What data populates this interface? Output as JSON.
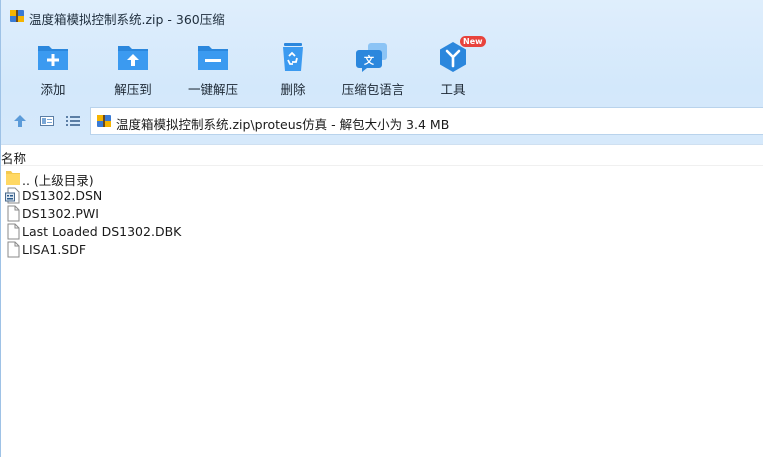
{
  "window": {
    "title": "温度箱模拟控制系统.zip - 360压缩",
    "app_icon": "archive-icon"
  },
  "toolbar": {
    "items": [
      {
        "label": "添加",
        "icon": "add-folder-icon"
      },
      {
        "label": "解压到",
        "icon": "extract-to-icon"
      },
      {
        "label": "一键解压",
        "icon": "one-click-extract-icon"
      },
      {
        "label": "删除",
        "icon": "recycle-bin-icon"
      },
      {
        "label": "压缩包语言",
        "icon": "language-icon"
      },
      {
        "label": "工具",
        "icon": "tools-icon",
        "badge": "New"
      }
    ]
  },
  "address": {
    "path": "温度箱模拟控制系统.zip\\proteus仿真 - 解包大小为 3.4 MB",
    "icons": [
      "up-arrow-icon",
      "view-icon",
      "list-icon",
      "archive-icon"
    ]
  },
  "list": {
    "column_name": "名称",
    "files": [
      {
        "name": ".. (上级目录)",
        "icon": "folder-icon"
      },
      {
        "name": "DS1302.DSN",
        "icon": "dsn-file-icon"
      },
      {
        "name": "DS1302.PWI",
        "icon": "file-icon"
      },
      {
        "name": "Last Loaded DS1302.DBK",
        "icon": "file-icon"
      },
      {
        "name": "LISA1.SDF",
        "icon": "file-icon"
      }
    ]
  },
  "colors": {
    "accent": "#2e8ae0",
    "toolbar_bg": "#d6e9fb",
    "badge": "#e8433c"
  }
}
